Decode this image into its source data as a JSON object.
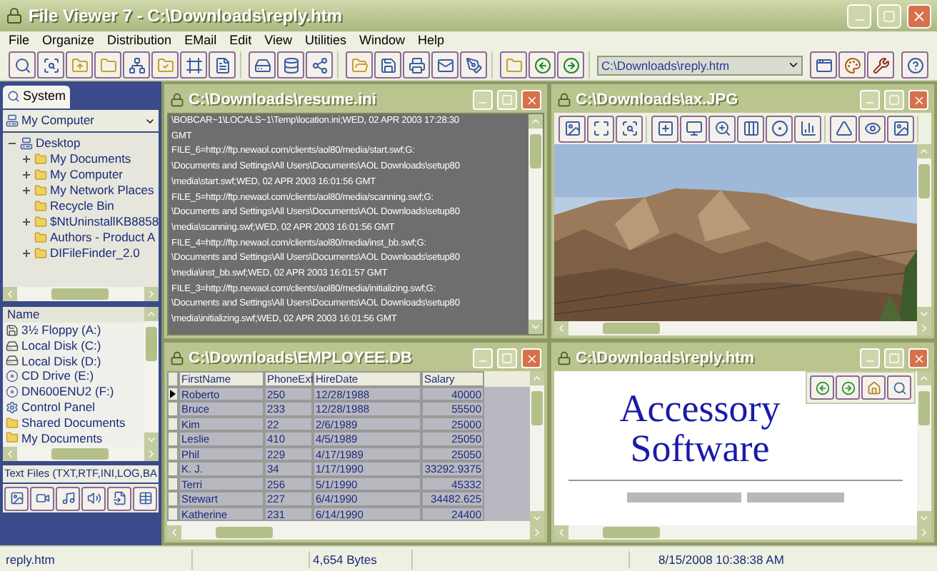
{
  "window": {
    "title": "File Viewer 7 - C:\\Downloads\\reply.htm"
  },
  "menu": [
    "File",
    "Organize",
    "Distribution",
    "EMail",
    "Edit",
    "View",
    "Utilities",
    "Window",
    "Help"
  ],
  "address": {
    "value": "C:\\Downloads\\reply.htm"
  },
  "sidebar": {
    "tab": "System",
    "location": "My Computer",
    "tree": {
      "label": "Desktop",
      "expanded": true,
      "children": [
        {
          "label": "My Documents",
          "has_children": true
        },
        {
          "label": "My Computer",
          "has_children": true
        },
        {
          "label": "My Network Places",
          "has_children": true
        },
        {
          "label": "Recycle Bin",
          "has_children": false
        },
        {
          "label": "$NtUninstallKB8858",
          "has_children": true
        },
        {
          "label": "Authors - Product A",
          "has_children": false
        },
        {
          "label": "DIFileFinder_2.0",
          "has_children": true
        }
      ]
    },
    "list": {
      "column": "Name",
      "items": [
        {
          "label": "3½ Floppy (A:)",
          "kind": "floppy"
        },
        {
          "label": "Local Disk (C:)",
          "kind": "disk"
        },
        {
          "label": "Local Disk (D:)",
          "kind": "disk"
        },
        {
          "label": "CD Drive (E:)",
          "kind": "cd"
        },
        {
          "label": "DN600ENU2 (F:)",
          "kind": "cd"
        },
        {
          "label": "Control Panel",
          "kind": "panel"
        },
        {
          "label": "Shared Documents",
          "kind": "folder"
        },
        {
          "label": "My Documents",
          "kind": "folder"
        }
      ]
    },
    "filter": "Text Files (TXT,RTF,INI,LOG,BA"
  },
  "ini_window": {
    "title": "C:\\Downloads\\resume.ini",
    "lines": [
      "\\BOBCAR~1\\LOCALS~1\\Temp\\location.ini;WED, 02 APR 2003 17:28:30",
      "GMT",
      "FILE_6=http://ftp.newaol.com/clients/aol80/media/start.swf;G:",
      "\\Documents and Settings\\All Users\\Documents\\AOL Downloads\\setup80",
      "\\media\\start.swf;WED, 02 APR 2003 16:01:56 GMT",
      "FILE_5=http://ftp.newaol.com/clients/aol80/media/scanning.swf;G:",
      "\\Documents and Settings\\All Users\\Documents\\AOL Downloads\\setup80",
      "\\media\\scanning.swf;WED, 02 APR 2003 16:01:56 GMT",
      "FILE_4=http://ftp.newaol.com/clients/aol80/media/inst_bb.swf;G:",
      "\\Documents and Settings\\All Users\\Documents\\AOL Downloads\\setup80",
      "\\media\\inst_bb.swf;WED, 02 APR 2003 16:01:57 GMT",
      "FILE_3=http://ftp.newaol.com/clients/aol80/media/initializing.swf;G:",
      "\\Documents and Settings\\All Users\\Documents\\AOL Downloads\\setup80",
      "\\media\\initializing.swf;WED, 02 APR 2003 16:01:56 GMT"
    ]
  },
  "image_window": {
    "title": "C:\\Downloads\\ax.JPG"
  },
  "table_window": {
    "title": "C:\\Downloads\\EMPLOYEE.DB",
    "columns": [
      "FirstName",
      "PhoneExt",
      "HireDate",
      "Salary"
    ],
    "rows": [
      {
        "cells": [
          "Roberto",
          "250",
          "12/28/1988",
          "40000"
        ],
        "current": true
      },
      {
        "cells": [
          "Bruce",
          "233",
          "12/28/1988",
          "55500"
        ],
        "current": false
      },
      {
        "cells": [
          "Kim",
          "22",
          "2/6/1989",
          "25000"
        ],
        "current": false
      },
      {
        "cells": [
          "Leslie",
          "410",
          "4/5/1989",
          "25050"
        ],
        "current": false
      },
      {
        "cells": [
          "Phil",
          "229",
          "4/17/1989",
          "25050"
        ],
        "current": false
      },
      {
        "cells": [
          "K. J.",
          "34",
          "1/17/1990",
          "33292.9375"
        ],
        "current": false
      },
      {
        "cells": [
          "Terri",
          "256",
          "5/1/1990",
          "45332"
        ],
        "current": false
      },
      {
        "cells": [
          "Stewart",
          "227",
          "6/4/1990",
          "34482.625"
        ],
        "current": false
      },
      {
        "cells": [
          "Katherine",
          "231",
          "6/14/1990",
          "24400"
        ],
        "current": false
      }
    ]
  },
  "html_window": {
    "title": "C:\\Downloads\\reply.htm",
    "heading": [
      "Accessory",
      "Software"
    ]
  },
  "status_bar": [
    "reply.htm",
    "4,654 Bytes",
    "8/15/2008 10:38:38 AM"
  ]
}
